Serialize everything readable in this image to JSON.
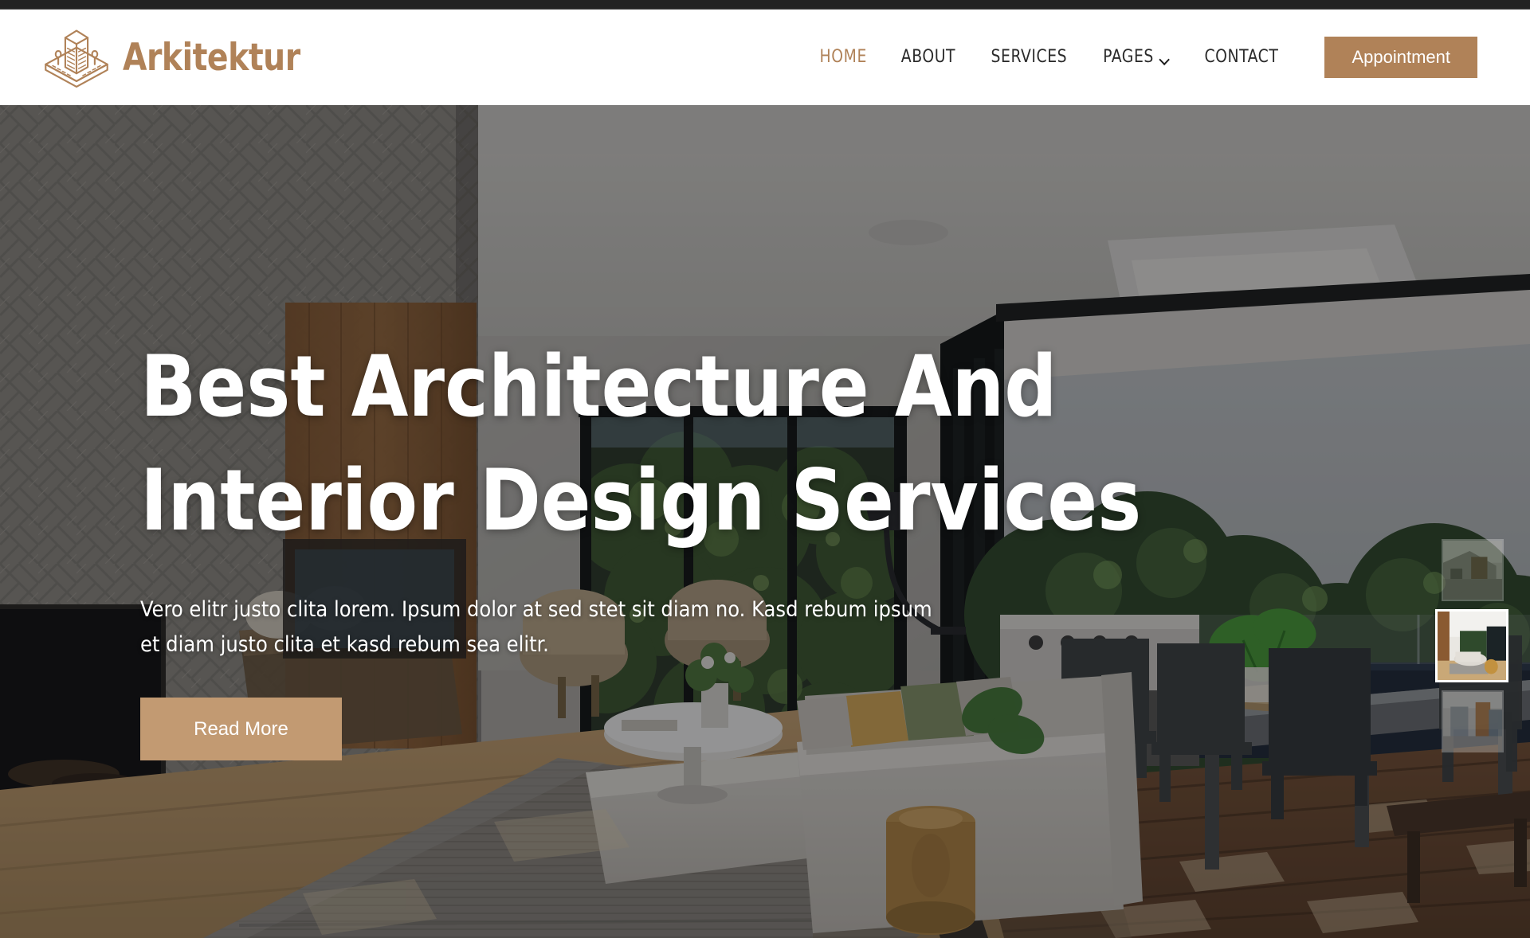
{
  "brand": {
    "name": "Arkitektur",
    "icon": "building-logo-icon",
    "color": "#b08258"
  },
  "nav": {
    "items": [
      {
        "label": "HOME",
        "active": true,
        "caret": false
      },
      {
        "label": "ABOUT",
        "active": false,
        "caret": false
      },
      {
        "label": "SERVICES",
        "active": false,
        "caret": false
      },
      {
        "label": "PAGES",
        "active": false,
        "caret": true
      },
      {
        "label": "CONTACT",
        "active": false,
        "caret": false
      }
    ],
    "appointment_label": "Appointment"
  },
  "hero": {
    "title_line1": "Best Architecture And",
    "title_line2": "Interior Design Services",
    "subtitle": "Vero elitr justo clita lorem. Ipsum dolor at sed stet sit diam no. Kasd rebum ipsum et diam justo clita et kasd rebum sea elitr.",
    "cta_label": "Read More",
    "image_alt": "Modern open-plan living room with herringbone stone wall, sectional sofa, floor-to-ceiling glass doors opening onto a timber deck with dining set",
    "overlay_color": "#0c0c0e"
  },
  "carousel": {
    "thumbs": [
      {
        "name": "thumb-exterior",
        "active": false
      },
      {
        "name": "thumb-living-room",
        "active": true
      },
      {
        "name": "thumb-interior-hall",
        "active": false
      }
    ]
  },
  "theme": {
    "accent": "#b08258",
    "accent_light": "#c29a72",
    "text_dark": "#2b2b2b",
    "white": "#ffffff"
  }
}
